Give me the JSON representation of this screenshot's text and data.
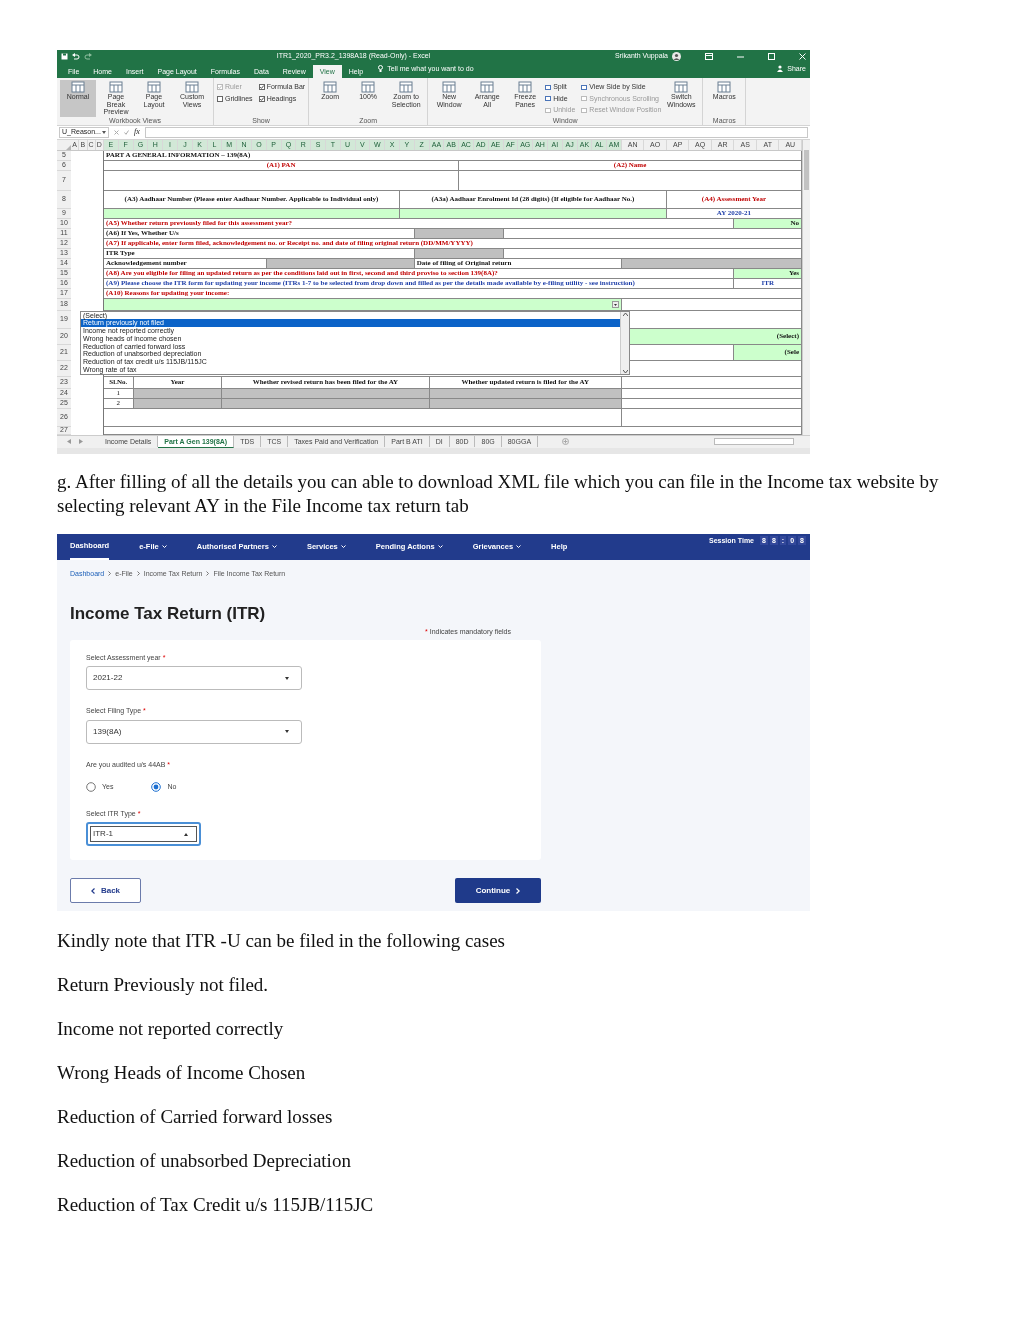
{
  "excel": {
    "title": "ITR1_2020_PR3.2_1398A18 (Read-Only) - Excel",
    "user": "Srikanth Vuppala",
    "menu": [
      {
        "label": "File",
        "selected": false
      },
      {
        "label": "Home",
        "selected": false
      },
      {
        "label": "Insert",
        "selected": false
      },
      {
        "label": "Page Layout",
        "selected": false
      },
      {
        "label": "Formulas",
        "selected": false
      },
      {
        "label": "Data",
        "selected": false
      },
      {
        "label": "Review",
        "selected": false
      },
      {
        "label": "View",
        "selected": true
      },
      {
        "label": "Help",
        "selected": false
      }
    ],
    "tell_me": "Tell me what you want to do",
    "share": "Share",
    "ribbon_groups": [
      {
        "name": "Workbook Views",
        "items": [
          {
            "kind": "large",
            "label": "Normal",
            "selected": true
          },
          {
            "kind": "large",
            "label": "Page Break Preview",
            "selected": false
          },
          {
            "kind": "large",
            "label": "Page Layout",
            "selected": false
          },
          {
            "kind": "large",
            "label": "Custom Views",
            "selected": false
          }
        ]
      },
      {
        "name": "Show",
        "items": [
          {
            "kind": "check",
            "label": "Ruler",
            "checked": true,
            "disabled": true
          },
          {
            "kind": "check",
            "label": "Gridlines",
            "checked": false,
            "disabled": false
          },
          {
            "kind": "check",
            "label": "Formula Bar",
            "checked": true,
            "disabled": false
          },
          {
            "kind": "check",
            "label": "Headings",
            "checked": true,
            "disabled": false
          }
        ]
      },
      {
        "name": "Zoom",
        "items": [
          {
            "kind": "large",
            "label": "Zoom"
          },
          {
            "kind": "large",
            "label": "100%"
          },
          {
            "kind": "large",
            "label": "Zoom to Selection"
          }
        ]
      },
      {
        "name": "Window",
        "items": [
          {
            "kind": "large",
            "label": "New Window"
          },
          {
            "kind": "large",
            "label": "Arrange All"
          },
          {
            "kind": "large",
            "label": "Freeze Panes"
          },
          {
            "kind": "small",
            "label": "Split",
            "disabled": false
          },
          {
            "kind": "small",
            "label": "Hide",
            "disabled": false
          },
          {
            "kind": "small",
            "label": "Unhide",
            "disabled": true
          },
          {
            "kind": "small",
            "label": "View Side by Side",
            "disabled": false
          },
          {
            "kind": "small",
            "label": "Synchronous Scrolling",
            "disabled": true
          },
          {
            "kind": "small",
            "label": "Reset Window Position",
            "disabled": true
          },
          {
            "kind": "large",
            "label": "Switch Windows"
          }
        ]
      },
      {
        "name": "Macros",
        "items": [
          {
            "kind": "large",
            "label": "Macros"
          }
        ]
      }
    ],
    "name_box": "U_Reason...",
    "fx": "fx",
    "column_letters": [
      "A",
      "B",
      "C",
      "D",
      "E",
      "F",
      "G",
      "H",
      "I",
      "J",
      "K",
      "L",
      "M",
      "N",
      "O",
      "P",
      "Q",
      "R",
      "S",
      "T",
      "U",
      "V",
      "W",
      "X",
      "Y",
      "Z",
      "AA",
      "AB",
      "AC",
      "AD",
      "AE",
      "AF",
      "AG",
      "AH",
      "AI",
      "AJ",
      "AK",
      "AL",
      "AM",
      "AN",
      "AO",
      "AP",
      "AQ",
      "AR",
      "AS",
      "AT",
      "AU"
    ],
    "rows": [
      {
        "number": "5",
        "kind": "heading",
        "cells": [
          {
            "kind": "label",
            "text": "PART A GENERAL INFORMATION – 139(8A)"
          }
        ]
      },
      {
        "number": "6",
        "kind": "pair",
        "cells": [
          {
            "kind": "caption",
            "text": "(A1) PAN"
          },
          {
            "kind": "caption",
            "text": "(A2) Name"
          }
        ]
      },
      {
        "number": "7",
        "kind": "pair",
        "cells": [
          {
            "kind": "blank"
          },
          {
            "kind": "blank"
          }
        ]
      },
      {
        "number": "8",
        "kind": "triple",
        "cells": [
          {
            "kind": "header",
            "text": "(A3) Aadhaar Number (Please enter  Aadhaar Number. Applicable to Individual only)"
          },
          {
            "kind": "header",
            "text": "(A3a) Aadhaar Enrolment Id (28 digits) (If eligible for Aadhaar No.)"
          },
          {
            "kind": "caption",
            "text": "(A4) Assessment Year"
          }
        ]
      },
      {
        "number": "9",
        "kind": "triple",
        "cells": [
          {
            "kind": "input"
          },
          {
            "kind": "input"
          },
          {
            "kind": "value",
            "text": "AY 2020-21"
          }
        ]
      },
      {
        "number": "10",
        "kind": "qa",
        "cells": [
          {
            "kind": "question",
            "text": "(A5) Whether return previously filed for this assessment year?"
          },
          {
            "kind": "input",
            "text": "No"
          }
        ]
      },
      {
        "number": "11",
        "kind": "lgw",
        "cells": [
          {
            "kind": "label",
            "text": "(A6) If Yes, Whether U/s"
          },
          {
            "kind": "locked"
          },
          {
            "kind": "blank"
          }
        ]
      },
      {
        "number": "12",
        "kind": "wide",
        "cells": [
          {
            "kind": "question",
            "text": "(A7) If applicable, enter form filed, acknowledgement no. or Receipt no. and date of filing original return (DD/MM/YYYY)"
          }
        ]
      },
      {
        "number": "13",
        "kind": "lgw",
        "cells": [
          {
            "kind": "label",
            "text": "ITR Type"
          },
          {
            "kind": "locked"
          },
          {
            "kind": "blank"
          }
        ]
      },
      {
        "number": "14",
        "kind": "ack",
        "cells": [
          {
            "kind": "label",
            "text": "Acknowledgement number"
          },
          {
            "kind": "locked"
          },
          {
            "kind": "label",
            "text": "Date of filing of Original return"
          },
          {
            "kind": "locked"
          }
        ]
      },
      {
        "number": "15",
        "kind": "qa",
        "cells": [
          {
            "kind": "question",
            "text": "(A8) Are you eligible for filing an updated return as per the conditions laid out in first, second and third proviso to section 139(8A)?"
          },
          {
            "kind": "input",
            "text": "Yes"
          }
        ]
      },
      {
        "number": "16",
        "kind": "qa",
        "cells": [
          {
            "kind": "note",
            "text": "(A9) Please choose the ITR form for updating your income (ITRs 1-7 to be selected from drop down and filled as per the details made available by e-filing utility - see instruction)"
          },
          {
            "kind": "value",
            "text": "ITR"
          }
        ]
      },
      {
        "number": "17",
        "kind": "wide",
        "cells": [
          {
            "kind": "question",
            "text": "(A10) Reasons for updating your income:"
          }
        ]
      },
      {
        "number": "18",
        "kind": "select",
        "cells": [
          {
            "kind": "input"
          },
          {
            "kind": "blank"
          }
        ]
      },
      {
        "number": "19",
        "kind": "blank",
        "cells": [
          {
            "kind": "blank"
          }
        ]
      },
      {
        "number": "20",
        "kind": "side2",
        "cells": [
          {
            "kind": "blank"
          },
          {
            "kind": "input",
            "text": "(Select)"
          }
        ]
      },
      {
        "number": "21",
        "kind": "side3",
        "cells": [
          {
            "kind": "blank"
          },
          {
            "kind": "blank"
          },
          {
            "kind": "input",
            "text": "(Sele"
          }
        ]
      },
      {
        "number": "22",
        "kind": "blank",
        "cells": [
          {
            "kind": "blank"
          }
        ]
      }
    ],
    "history_table": {
      "header_row": "23",
      "columns": [
        "Sl.No.",
        "Year",
        "Whether revised return has been filed for the AY",
        "Whether updated return is filed for the AY"
      ],
      "rows": [
        {
          "number": "24",
          "cells": [
            {
              "kind": "number",
              "text": "1"
            },
            {
              "kind": "locked"
            },
            {
              "kind": "locked"
            },
            {
              "kind": "locked"
            }
          ]
        },
        {
          "number": "25",
          "cells": [
            {
              "kind": "number",
              "text": "2"
            },
            {
              "kind": "locked"
            },
            {
              "kind": "locked"
            },
            {
              "kind": "locked"
            }
          ]
        }
      ]
    },
    "end_rows": [
      {
        "number": "26",
        "kind": "side2",
        "cells": [
          {
            "kind": "blank"
          },
          {
            "kind": "blank"
          }
        ]
      },
      {
        "number": "27",
        "kind": "blank",
        "cells": [
          {
            "kind": "blank"
          }
        ]
      }
    ],
    "dropdown": [
      {
        "label": "(Select)",
        "selected": false
      },
      {
        "label": "Return previously not filed",
        "selected": true
      },
      {
        "label": "Income not reported correctly",
        "selected": false
      },
      {
        "label": "Wrong heads of income chosen",
        "selected": false
      },
      {
        "label": "Reduction of carried forward loss",
        "selected": false
      },
      {
        "label": "Reduction of unabsorbed depreciation",
        "selected": false
      },
      {
        "label": "Reduction of tax credit u/s 115JB/115JC",
        "selected": false
      },
      {
        "label": "Wrong rate of tax",
        "selected": false
      }
    ],
    "sheet_tabs": [
      {
        "label": "Income Details",
        "selected": false
      },
      {
        "label": "Part A Gen 139(8A)",
        "selected": true
      },
      {
        "label": "TDS",
        "selected": false
      },
      {
        "label": "TCS",
        "selected": false
      },
      {
        "label": "Taxes Paid and Verification",
        "selected": false
      },
      {
        "label": "Part B ATI",
        "selected": false
      },
      {
        "label": "DI",
        "selected": false
      },
      {
        "label": "80D",
        "selected": false
      },
      {
        "label": "80G",
        "selected": false
      },
      {
        "label": "80GGA",
        "selected": false
      }
    ]
  },
  "step": "g. After filling of all the details you can able to download XML file which you can file in the Income tax website by selecting relevant AY in the File Income tax return tab",
  "portal": {
    "nav": [
      {
        "label": "Dashboard",
        "selected": true,
        "dropdown": false
      },
      {
        "label": "e-File",
        "selected": false,
        "dropdown": true
      },
      {
        "label": "Authorised Partners",
        "selected": false,
        "dropdown": true
      },
      {
        "label": "Services",
        "selected": false,
        "dropdown": true
      },
      {
        "label": "Pending Actions",
        "selected": false,
        "dropdown": true
      },
      {
        "label": "Grievances",
        "selected": false,
        "dropdown": true
      },
      {
        "label": "Help",
        "selected": false,
        "dropdown": false
      }
    ],
    "session_label": "Session Time",
    "session_digits": [
      "8",
      "8",
      ":",
      "0",
      "8"
    ],
    "breadcrumb": [
      {
        "label": "Dashboard",
        "link": true
      },
      {
        "label": "e-File",
        "link": false
      },
      {
        "label": "Income Tax Return",
        "link": false
      },
      {
        "label": "File Income Tax Return",
        "link": false
      }
    ],
    "title": "Income Tax Return (ITR)",
    "mandatory_mark": "*",
    "mandatory_note": "Indicates mandatory fields",
    "fields": [
      {
        "kind": "select",
        "label": "Select Assessment year",
        "mark": "*",
        "value": "2021-22",
        "focused": false
      },
      {
        "kind": "select",
        "label": "Select Filing Type",
        "mark": "*",
        "value": "139(8A)",
        "focused": false
      },
      {
        "kind": "radio",
        "label": "Are you audited u/s 44AB",
        "mark": "*",
        "options": [
          {
            "label": "Yes",
            "selected": false
          },
          {
            "label": "No",
            "selected": true
          }
        ]
      },
      {
        "kind": "select",
        "label": "Select ITR Type",
        "mark": "*",
        "value": "ITR-1",
        "focused": true
      }
    ],
    "back": "Back",
    "continue": "Continue"
  },
  "note": "Kindly note that ITR -U can be filed in the following cases",
  "cases": [
    "Return Previously not filed.",
    "Income not reported correctly",
    "Wrong Heads of Income Chosen",
    "Reduction of Carried forward losses",
    "Reduction of unabsorbed Depreciation",
    "Reduction of Tax Credit u/s 115JB/115JC"
  ]
}
